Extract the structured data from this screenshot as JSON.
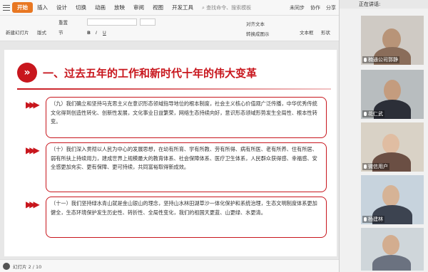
{
  "ribbon": {
    "tabs": [
      "开始",
      "插入",
      "设计",
      "切换",
      "动画",
      "放映",
      "审阅",
      "视图",
      "开发工具"
    ],
    "search_placeholder": "查找命令、搜索模板",
    "right": [
      "未同步",
      "协作",
      "分享"
    ]
  },
  "toolbar": {
    "new_slide": "新建幻灯片",
    "layout": "版式",
    "section": "节",
    "reset": "重置",
    "text_direction": "对齐文本",
    "convert_smartart": "转换成图示",
    "text_box": "文本框",
    "shape": "形状",
    "font_size_box": ""
  },
  "slide": {
    "title_badge": "»",
    "title": "一、过去五年的工作和新时代十年的伟大变革",
    "items": [
      {
        "text": "（九）我们确立和坚持马克思主义在意识形态领域指导地位的根本制度，社会主义核心价值观广泛传播，中华优秀传统文化得到创造性转化、创新性发展，文化事业日益繁荣，网络生态持续向好，意识形态领域形势发生全局性、根本性转变。"
      },
      {
        "text": "（十）我们深入贯彻以人民为中心的发展思想，在幼有所育、学有所教、劳有所得、病有所医、老有所养、住有所居、弱有所扶上持续用力，建成世界上规模最大的教育体系、社会保障体系、医疗卫生体系，人民群众获得感、幸福感、安全感更加充实、更有保障、更可持续，共同富裕取得新成效。"
      },
      {
        "text": "（十一）我们坚持绿水青山就是金山银山的理念，坚持山水林田湖草沙一体化保护和系统治理，生态文明制度体系更加健全，生态环境保护发生历史性、转折性、全局性变化，我们的祖国天更蓝、山更绿、水更清。"
      }
    ]
  },
  "status": {
    "text": "幻灯片 2 / 10"
  },
  "sidebar": {
    "speaking": "正在讲话:",
    "participants": [
      "楠通公司郭静",
      "花仁武",
      "微信用户",
      "杨建林",
      ""
    ]
  },
  "colors": {
    "accent": "#c8161d",
    "tab_active": "#e87722"
  }
}
